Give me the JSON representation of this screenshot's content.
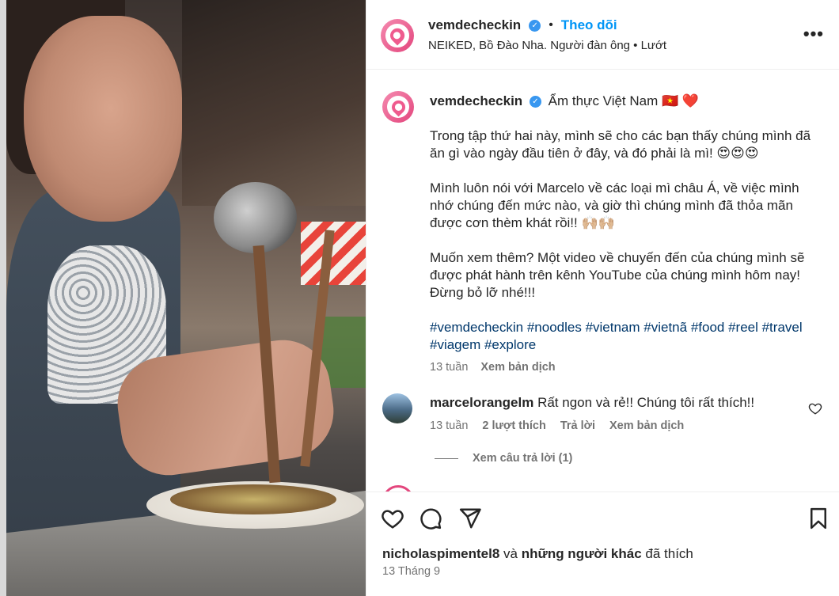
{
  "post": {
    "username": "vemdecheckin",
    "follow_label": "Theo dõi",
    "header_separator": "•",
    "audio_line": "NEIKED, Bồ Đào Nha. Người đàn ông • Lướt",
    "more_label": "•••",
    "caption": {
      "title": "Ẩm thực Việt Nam 🇻🇳 ❤️",
      "paragraph1": "Trong tập thứ hai này, mình sẽ cho các bạn thấy chúng mình đã ăn gì vào ngày đầu tiên ở đây, và đó phải là mì! 😍😍😍",
      "paragraph2": "Mình luôn nói với Marcelo về các loại mì châu Á, về việc mình nhớ chúng đến mức nào, và giờ thì chúng mình đã thỏa mãn được cơn thèm khát rồi!! 🙌🏼🙌🏼",
      "paragraph3": "Muốn xem thêm? Một video về chuyến đến của chúng mình sẽ được phát hành trên kênh YouTube của chúng mình hôm nay! Đừng bỏ lỡ nhé!!!",
      "hashtags": "#vemdecheckin #noodles #vietnam #vietnã #food #reel #travel #viagem #explore",
      "time": "13 tuần",
      "translate": "Xem bản dịch"
    },
    "comment": {
      "username": "marcelorangelm",
      "text": "Rất ngon và rẻ!! Chúng tôi rất thích!!",
      "time": "13 tuần",
      "likes": "2 lượt thích",
      "reply": "Trả lời",
      "translate": "Xem bản dịch",
      "view_replies": "Xem câu trả lời (1)"
    },
    "liked_by_user": "nicholaspimentel8",
    "liked_by_mid": " và ",
    "liked_by_others": "những người khác",
    "liked_by_suffix": " đã thích",
    "date": "13 Tháng 9"
  },
  "icons": [
    "more-icon",
    "verified-icon",
    "heart-icon",
    "comment-icon",
    "share-icon",
    "bookmark-icon"
  ],
  "colors": {
    "accent": "#0095f6",
    "verified": "#3897f0",
    "brand_pink": "#ef5b8e",
    "hashtag": "#00376b"
  }
}
